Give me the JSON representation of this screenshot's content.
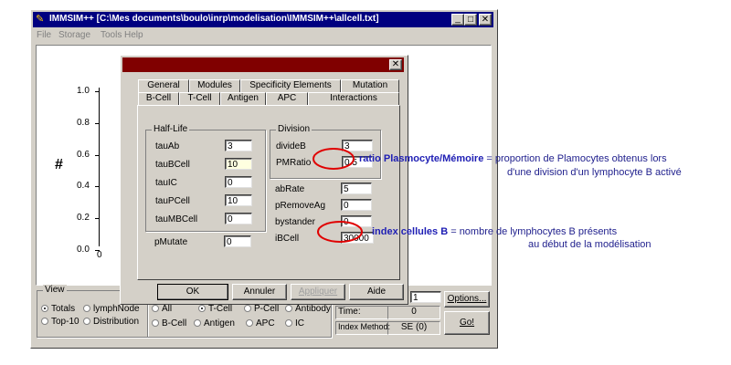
{
  "window": {
    "title": "IMMSIM++ [C:\\Mes documents\\boulo\\inrp\\modelisation\\IMMSIM++\\allcell.txt]",
    "menu": [
      "File",
      "Storage",
      "Tools",
      "Help"
    ],
    "controls": {
      "minimize": "_",
      "maximize": "□",
      "close": "✕"
    }
  },
  "plot": {
    "y_ticks": [
      "1.0",
      "0.8",
      "0.6",
      "0.4",
      "0.2",
      "0.0"
    ],
    "x_tick": "0",
    "ylabel": "#"
  },
  "dialog": {
    "close": "✕",
    "tabs_row1": [
      "General",
      "Modules",
      "Specificity Elements",
      "Mutation"
    ],
    "tabs_row2": [
      "B-Cell",
      "T-Cell",
      "Antigen",
      "APC",
      "Interactions"
    ],
    "half_life": {
      "title": "Half-Life",
      "fields": [
        {
          "label": "tauAb",
          "value": "3"
        },
        {
          "label": "tauBCell",
          "value": "10"
        },
        {
          "label": "tauIC",
          "value": "0"
        },
        {
          "label": "tauPCell",
          "value": "10"
        },
        {
          "label": "tauMBCell",
          "value": "0"
        }
      ]
    },
    "pmutate": {
      "label": "pMutate",
      "value": "0"
    },
    "division": {
      "title": "Division",
      "fields": [
        {
          "label": "divideB",
          "value": "3"
        },
        {
          "label": "PMRatio",
          "value": "0.5"
        }
      ]
    },
    "right_fields": [
      {
        "label": "abRate",
        "value": "5"
      },
      {
        "label": "pRemoveAg",
        "value": "0"
      },
      {
        "label": "bystander",
        "value": "0"
      },
      {
        "label": "iBCell",
        "value": "30000"
      }
    ],
    "buttons": {
      "ok": "OK",
      "cancel": "Annuler",
      "apply": "Appliquer",
      "help": "Aide"
    }
  },
  "view": {
    "title": "View",
    "radios": [
      {
        "label": "Totals",
        "on": true
      },
      {
        "label": "lymphNode",
        "on": false
      },
      {
        "label": "Top-10",
        "on": false
      },
      {
        "label": "Distribution",
        "on": false
      }
    ],
    "cells_row1": [
      {
        "label": "All",
        "on": false
      },
      {
        "label": "T-Cell",
        "on": true
      },
      {
        "label": "P-Cell",
        "on": false
      },
      {
        "label": "Antibody",
        "on": false
      }
    ],
    "cells_row2": [
      {
        "label": "B-Cell",
        "on": false
      },
      {
        "label": "Antigen",
        "on": false
      },
      {
        "label": "APC",
        "on": false
      },
      {
        "label": "IC",
        "on": false
      }
    ],
    "step_value": "1",
    "time_label": "Time:",
    "time_value": "0",
    "index_label": "Index Method:",
    "index_value": "SE (0)",
    "options_button": "Options...",
    "go_button": "Go!"
  },
  "annotations": {
    "pmratio_bold": "ratio Plasmocyte/Mémoire",
    "pmratio_rest": " = proportion de Plamocytes obtenus lors",
    "pmratio_line2": "d'une division d'un lymphocyte B activé",
    "ibcell_bold": "index cellules B",
    "ibcell_rest": " = nombre de lymphocytes B présents",
    "ibcell_line2": "au début de la modélisation"
  },
  "colors": {
    "titlebar": "#000080",
    "dialog_title": "#800000",
    "face": "#d4d0c8",
    "annotation": "#1e1eb4",
    "highlight": "#e00000"
  }
}
